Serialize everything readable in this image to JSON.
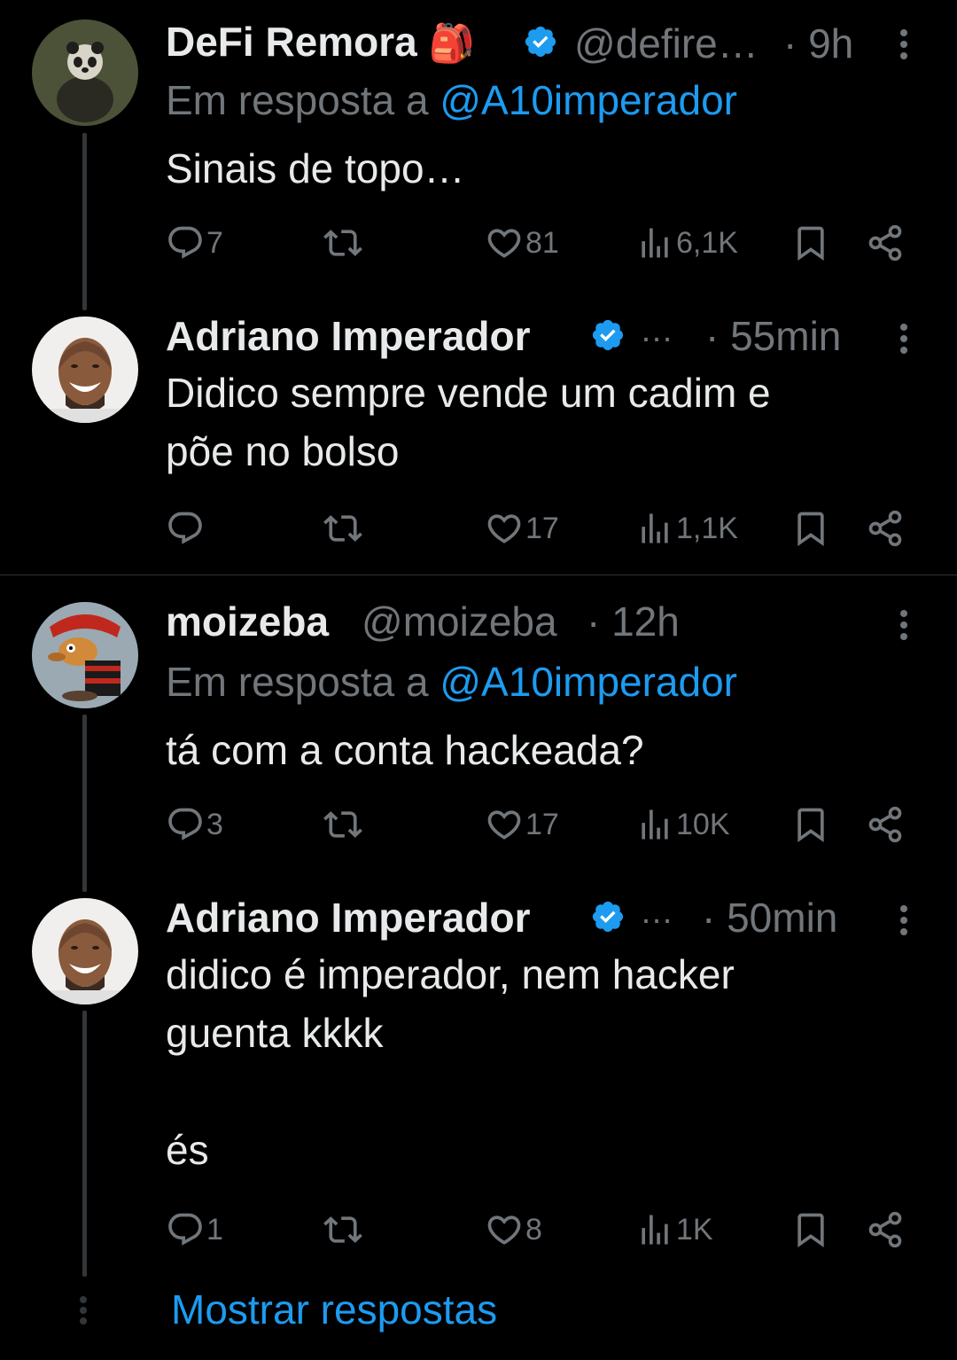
{
  "threads": [
    {
      "parent": {
        "author": "DeFi Remora",
        "emoji": "🎒",
        "handle": "@defire…",
        "time": "· 9h",
        "reply_prefix": "Em resposta a ",
        "reply_mention": "@A10imperador",
        "text": "Sinais de topo…",
        "replies": "7",
        "likes": "81",
        "views": "6,1K"
      },
      "reply": {
        "author": "Adriano Imperador",
        "handle": "…",
        "time": "· 55min",
        "text": "Didico sempre vende um cadim e\npõe no bolso",
        "replies": "",
        "likes": "17",
        "views": "1,1K"
      }
    },
    {
      "parent": {
        "author": "moizeba",
        "handle": "@moizeba",
        "time": "· 12h",
        "reply_prefix": "Em resposta a ",
        "reply_mention": "@A10imperador",
        "text": "tá com a conta hackeada?",
        "replies": "3",
        "likes": "17",
        "views": "10K"
      },
      "reply": {
        "author": "Adriano Imperador",
        "handle": "…",
        "time": "· 50min",
        "text": "didico é imperador, nem hacker\nguenta kkkk\n\nés",
        "replies": "1",
        "likes": "8",
        "views": "1K"
      }
    }
  ],
  "show_replies": "Mostrar respostas",
  "colors": {
    "background": "#000000",
    "text": "#e7e9ea",
    "muted": "#71767b",
    "accent": "#1d9bf0",
    "line": "#333639"
  },
  "icons": [
    "reply-icon",
    "retweet-icon",
    "like-icon",
    "views-icon",
    "bookmark-icon",
    "share-icon",
    "verified-badge-icon",
    "more-icon"
  ]
}
